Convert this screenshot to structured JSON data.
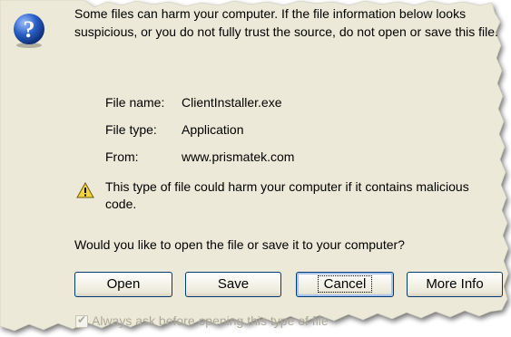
{
  "dialog": {
    "intro_text": "Some files can harm your computer. If the file information below looks suspicious, or you do not fully trust the source, do not open or save this file.",
    "file_info": {
      "name_label": "File name:",
      "name_value": "ClientInstaller.exe",
      "type_label": "File type:",
      "type_value": "Application",
      "from_label": "From:",
      "from_value": "www.prismatek.com"
    },
    "warning_text": "This type of file could harm your computer if it contains malicious code.",
    "question_text": "Would you like to open the file or save it to your computer?",
    "buttons": {
      "open_label": "Open",
      "save_label": "Save",
      "cancel_label": "Cancel",
      "more_info_label": "More Info"
    },
    "checkbox_label": "Always ask before opening this type of file",
    "checkbox_checked": true
  },
  "colors": {
    "dialog_background": "#ece9d8",
    "button_border": "#003c74",
    "disabled_text": "#aca899",
    "question_icon": "#2a5fc7",
    "warning_icon": "#f5d33a"
  },
  "icons": {
    "question": "question-icon",
    "warning": "warning-icon"
  }
}
